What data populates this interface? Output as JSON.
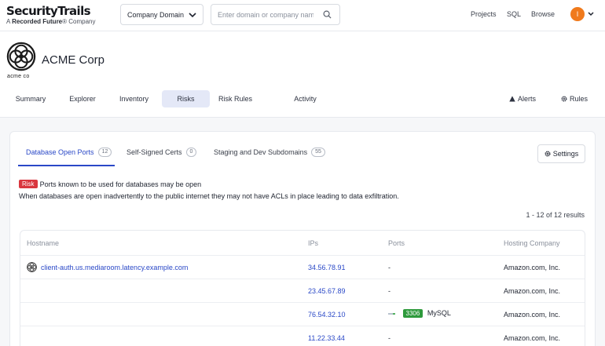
{
  "brand": {
    "name": "SecurityTrails",
    "tagline_prefix": "A ",
    "tagline_brand": "Recorded Future",
    "tagline_suffix": "® Company"
  },
  "search": {
    "type_selected": "Company Domain",
    "placeholder": "Enter domain or company name"
  },
  "top_nav": [
    "Projects",
    "SQL",
    "Browse"
  ],
  "user": {
    "avatar_initial": "I"
  },
  "company": {
    "logo_text": "acme co",
    "name": "ACME Corp"
  },
  "tabs": [
    "Summary",
    "Explorer",
    "Inventory",
    "Risks",
    "Risk Rules",
    "Activity"
  ],
  "active_tab": "Risks",
  "right_tabs": {
    "alerts": "Alerts",
    "rules": "Rules"
  },
  "risk_tabs": [
    {
      "label": "Database Open Ports",
      "count": "12",
      "active": true
    },
    {
      "label": "Self-Signed Certs",
      "count": "0",
      "active": false
    },
    {
      "label": "Staging and Dev Subdomains",
      "count": "55",
      "active": false
    }
  ],
  "settings_label": "Settings",
  "risk": {
    "badge": "Risk",
    "summary": "Ports known to be used for databases may be open",
    "description": "When databases are open inadvertently to the public internet they may not have ACLs in place leading to data exfiltration."
  },
  "results_text": "1 - 12 of 12 results",
  "table": {
    "headers": {
      "hostname": "Hostname",
      "ips": "IPs",
      "ports": "Ports",
      "hosting": "Hosting Company"
    },
    "rows": [
      {
        "hostname": "client-auth.us.mediaroom.latency.example.com",
        "ip": "34.56.78.91",
        "port": "-",
        "service": "",
        "hosting": "Amazon.com, Inc."
      },
      {
        "hostname": "",
        "ip": "23.45.67.89",
        "port": "-",
        "service": "",
        "hosting": "Amazon.com, Inc."
      },
      {
        "hostname": "",
        "ip": "76.54.32.10",
        "port": "3306",
        "service": "MySQL",
        "hosting": "Amazon.com, Inc."
      },
      {
        "hostname": "",
        "ip": "11.22.33.44",
        "port": "-",
        "service": "",
        "hosting": "Amazon.com, Inc."
      }
    ]
  },
  "colors": {
    "accent": "#2a48c7",
    "risk_red": "#d9363e",
    "port_green": "#2e9a3c",
    "avatar_orange": "#f07a1c",
    "active_tab_bg": "#e4e8f7"
  }
}
